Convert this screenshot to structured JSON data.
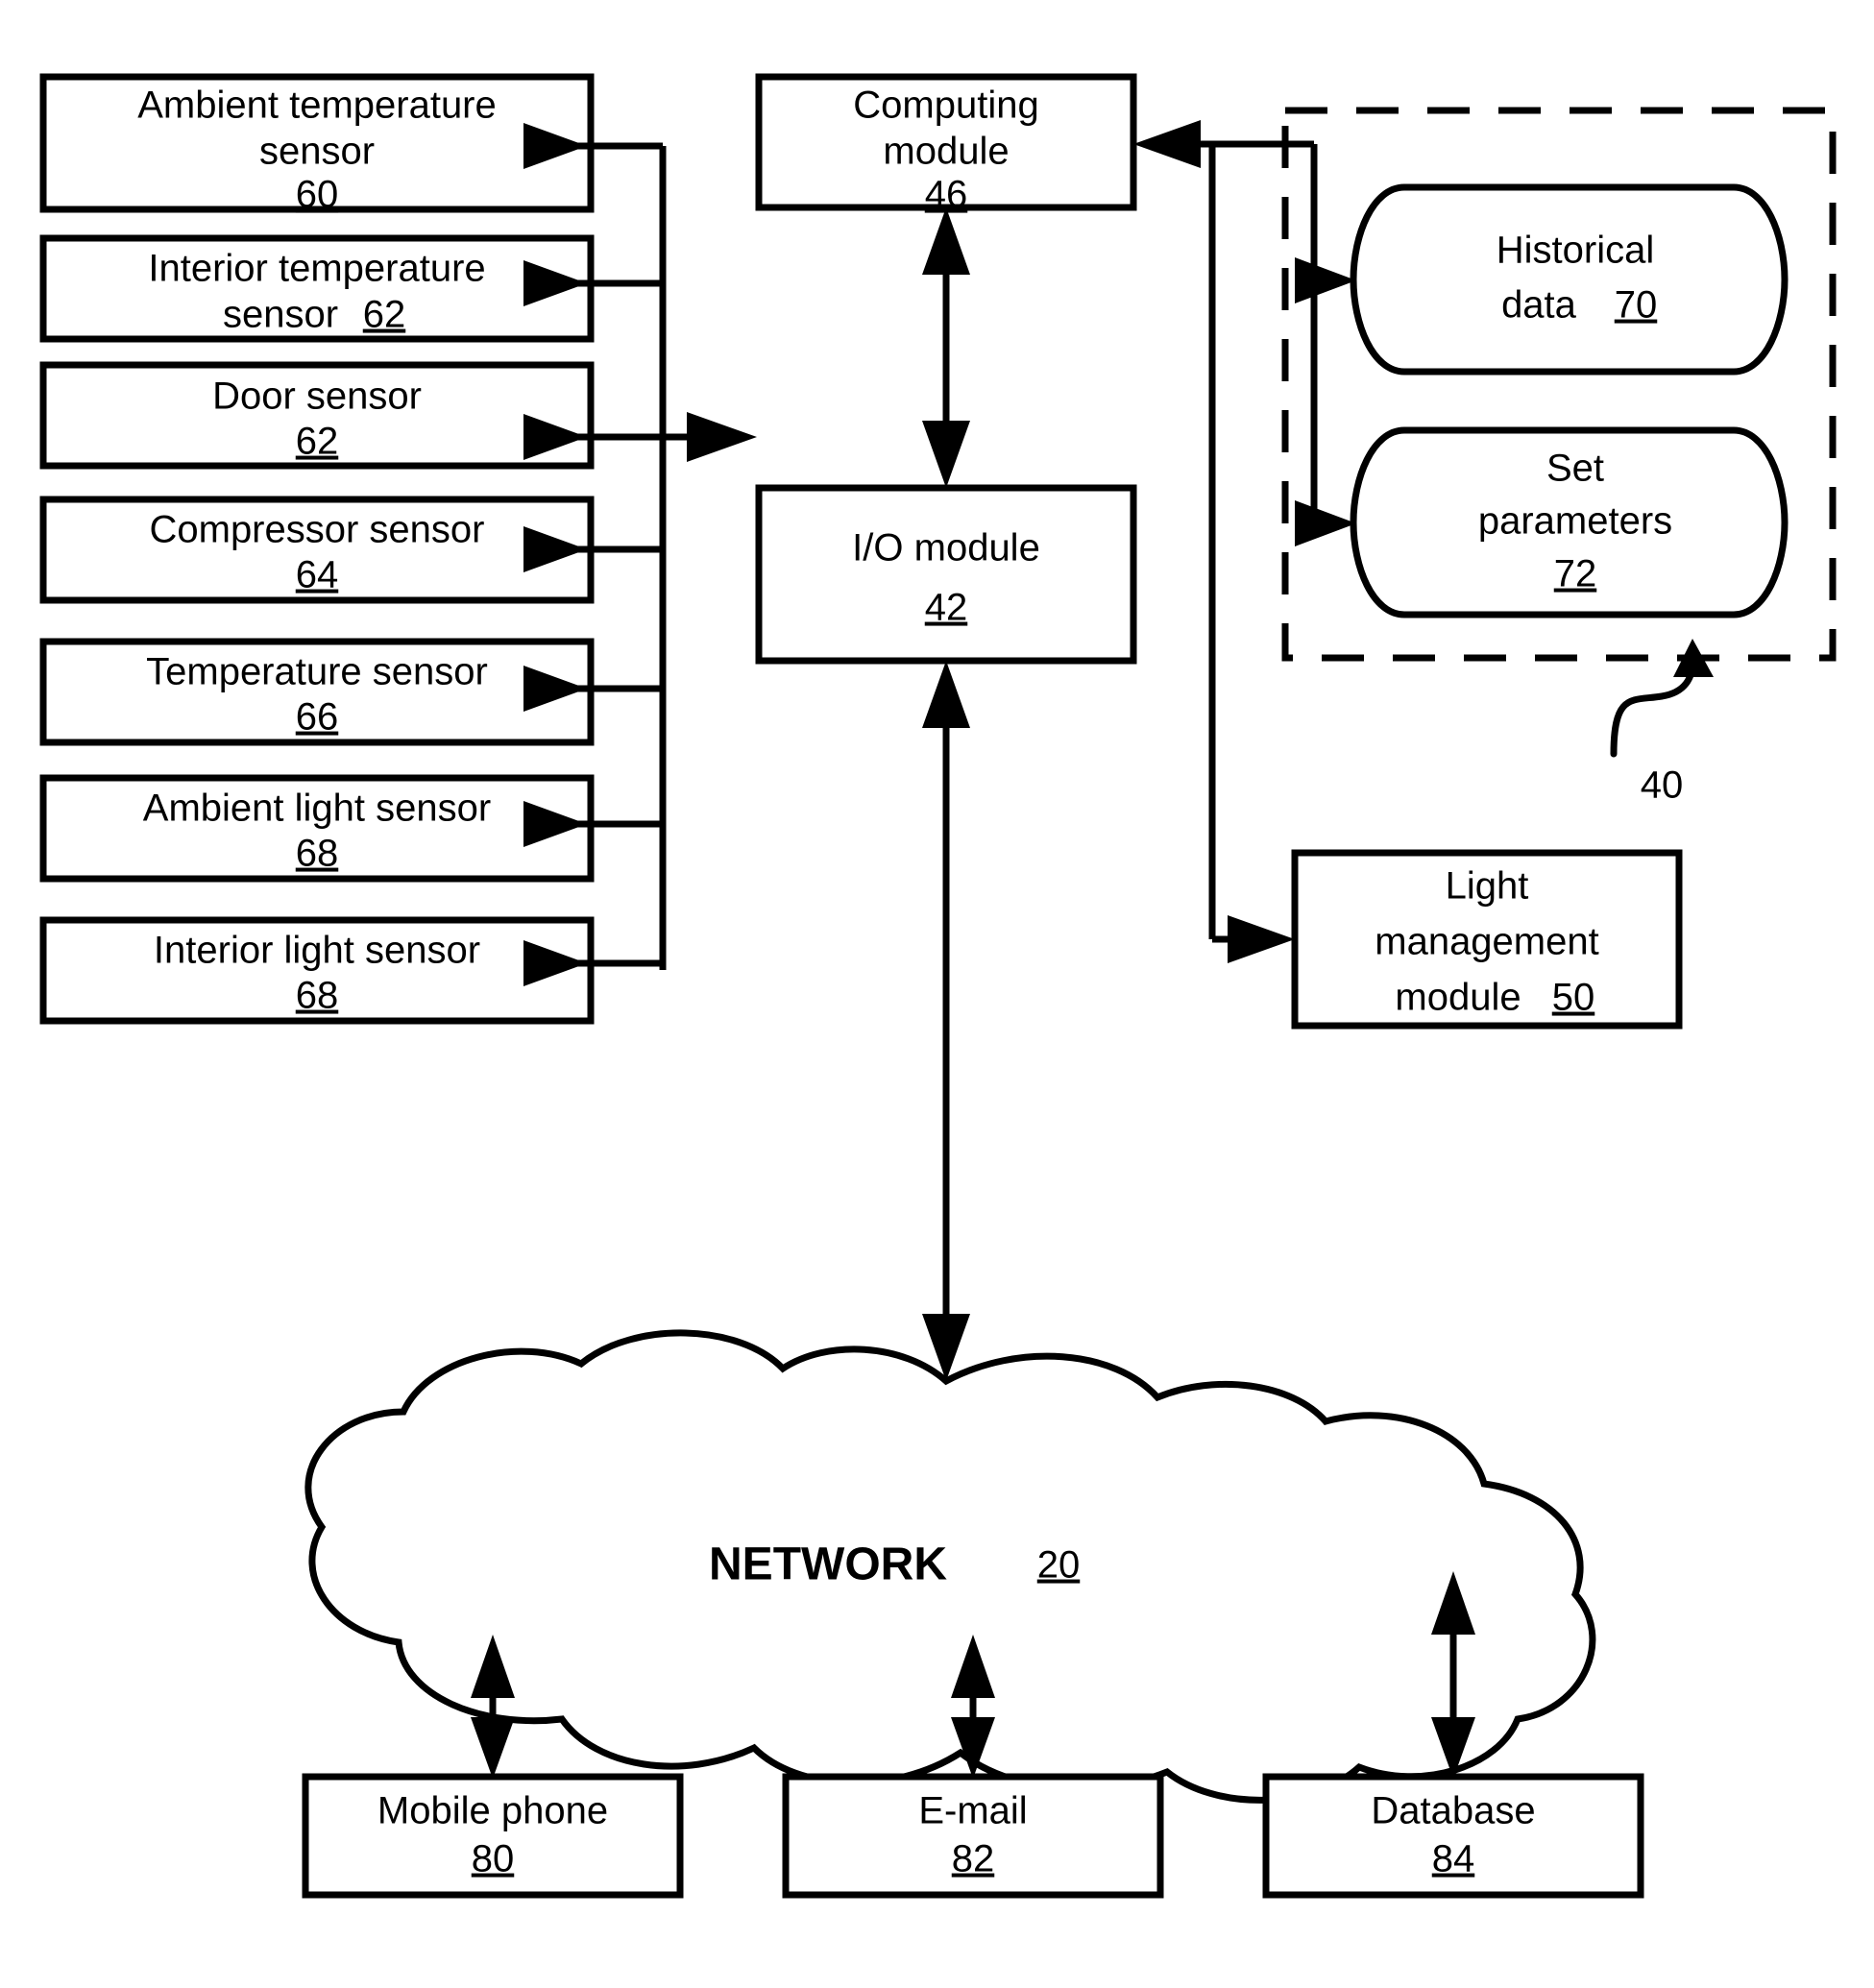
{
  "figure": {
    "type": "patent-block-diagram",
    "background": "#ffffff",
    "line_color": "#000000"
  },
  "sensors": [
    {
      "name": "ambient-temperature-sensor",
      "line1": "Ambient temperature",
      "line2": "sensor",
      "ref": "60",
      "ref_inline": false
    },
    {
      "name": "interior-temperature-sensor",
      "line1": "Interior temperature",
      "line2": "sensor",
      "ref": "62",
      "ref_inline": true
    },
    {
      "name": "door-sensor",
      "line1": "Door sensor",
      "line2": "",
      "ref": "62",
      "ref_inline": false
    },
    {
      "name": "compressor-sensor",
      "line1": "Compressor sensor",
      "line2": "",
      "ref": "64",
      "ref_inline": false
    },
    {
      "name": "temperature-sensor",
      "line1": "Temperature sensor",
      "line2": "",
      "ref": "66",
      "ref_inline": false
    },
    {
      "name": "ambient-light-sensor",
      "line1": "Ambient light sensor",
      "line2": "",
      "ref": "68",
      "ref_inline": false
    },
    {
      "name": "interior-light-sensor",
      "line1": "Interior light sensor",
      "line2": "",
      "ref": "68",
      "ref_inline": false
    }
  ],
  "modules": {
    "computing": {
      "line1": "Computing",
      "line2": "module",
      "ref": "46"
    },
    "io": {
      "line1": "I/O module",
      "line2": "",
      "ref": "42"
    },
    "light_management": {
      "line1": "Light",
      "line2": "management",
      "line3": "module",
      "ref": "50"
    }
  },
  "datastores": [
    {
      "name": "historical-data",
      "line1": "Historical",
      "line2": "data",
      "ref": "70"
    },
    {
      "name": "set-parameters",
      "line1": "Set",
      "line2": "parameters",
      "ref": "72"
    }
  ],
  "grouping": {
    "label": "40",
    "style": "dashed-box-with-curved-leader"
  },
  "network": {
    "label": "NETWORK",
    "ref": "20"
  },
  "endpoints": [
    {
      "name": "mobile-phone",
      "label": "Mobile phone",
      "ref": "80"
    },
    {
      "name": "email",
      "label": "E-mail",
      "ref": "82"
    },
    {
      "name": "database",
      "label": "Database",
      "ref": "84"
    }
  ]
}
